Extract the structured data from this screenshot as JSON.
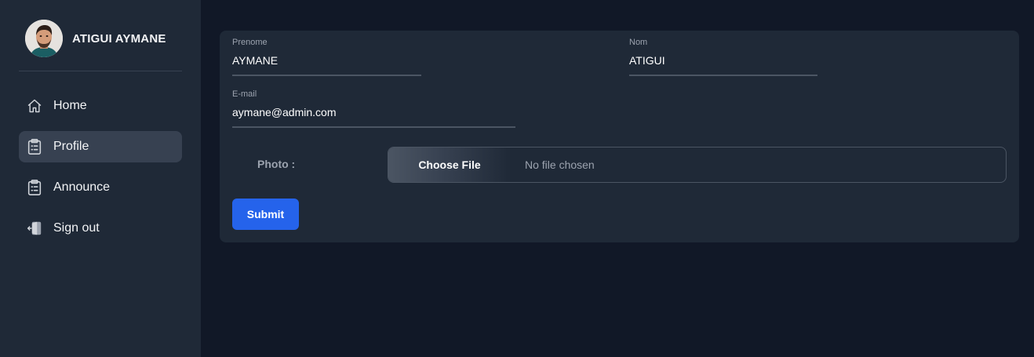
{
  "user": {
    "name": "ATIGUI AYMANE"
  },
  "nav": [
    {
      "label": "Home",
      "icon": "home-icon"
    },
    {
      "label": "Profile",
      "icon": "clipboard-icon",
      "active": true
    },
    {
      "label": "Announce",
      "icon": "clipboard-icon"
    },
    {
      "label": "Sign out",
      "icon": "sign-out-icon"
    }
  ],
  "form": {
    "prenome_label": "Prenome",
    "prenome_value": "AYMANE",
    "nom_label": "Nom",
    "nom_value": "ATIGUI",
    "email_label": "E-mail",
    "email_value": "aymane@admin.com",
    "photo_label": "Photo :",
    "file_button_label": "Choose File",
    "file_status": "No file chosen",
    "submit_label": "Submit"
  },
  "colors": {
    "background": "#111827",
    "panel": "#1f2937",
    "active_nav": "#374151",
    "accent": "#2563eb",
    "muted_text": "#9ca3af"
  }
}
